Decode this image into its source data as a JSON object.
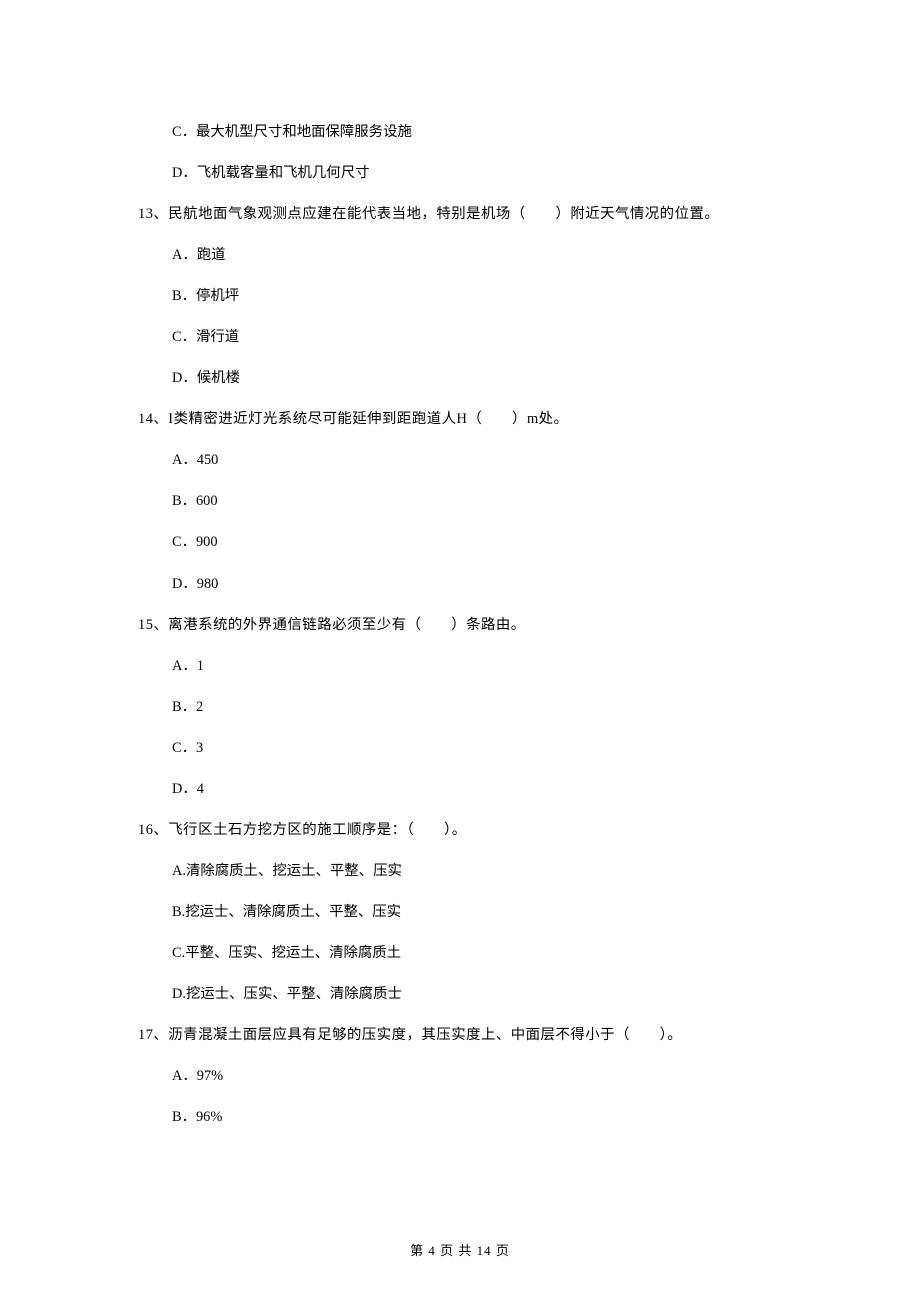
{
  "q12_opts": {
    "c": "C．最大机型尺寸和地面保障服务设施",
    "d": "D．飞机载客量和飞机几何尺寸"
  },
  "q13": {
    "stem": "13、民航地面气象观测点应建在能代表当地，特别是机场（　　）附近天气情况的位置。",
    "a": "A．跑道",
    "b": "B．停机坪",
    "c": "C．滑行道",
    "d": "D．候机楼"
  },
  "q14": {
    "stem": "14、I类精密进近灯光系统尽可能延伸到距跑道人H（　　）m处。",
    "a": "A．450",
    "b": "B．600",
    "c": "C．900",
    "d": "D．980"
  },
  "q15": {
    "stem": "15、离港系统的外界通信链路必须至少有（　　）条路由。",
    "a": "A．1",
    "b": "B．2",
    "c": "C．3",
    "d": "D．4"
  },
  "q16": {
    "stem": "16、飞行区土石方挖方区的施工顺序是：（　　）。",
    "a": "A.清除腐质土、挖运土、平整、压实",
    "b": "B.挖运士、清除腐质土、平整、压实",
    "c": "C.平整、压实、挖运土、清除腐质土",
    "d": "D.挖运士、压实、平整、清除腐质士"
  },
  "q17": {
    "stem": "17、沥青混凝土面层应具有足够的压实度，其压实度上、中面层不得小于（　　）。",
    "a": "A．97%",
    "b": "B．96%"
  },
  "footer": "第 4 页 共 14 页"
}
